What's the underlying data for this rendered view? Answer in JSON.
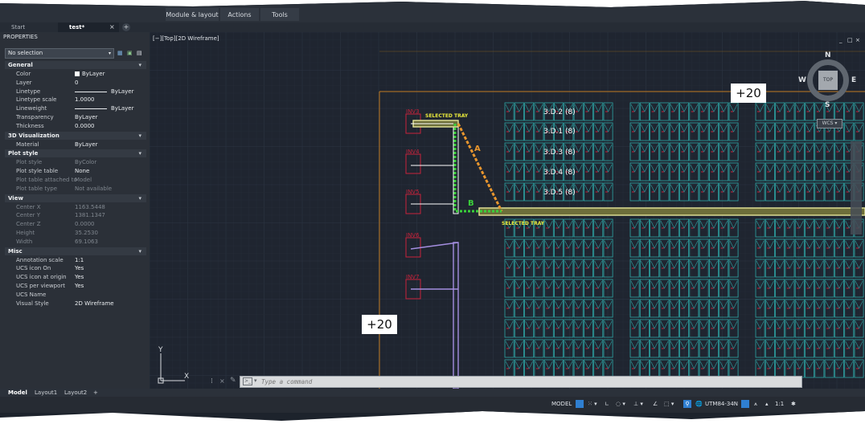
{
  "ribbon": {
    "tabs": [
      "Module & layout",
      "Actions",
      "Tools"
    ]
  },
  "doc_tabs": {
    "start": "Start",
    "active": "test*",
    "close": "×",
    "add": "+"
  },
  "properties": {
    "title": "PROPERTIES",
    "selection": "No selection",
    "sections": [
      {
        "name": "General",
        "rows": [
          {
            "key": "Color",
            "value": "ByLayer",
            "swatch": "#ffffff"
          },
          {
            "key": "Layer",
            "value": "0"
          },
          {
            "key": "Linetype",
            "value": "ByLayer",
            "line": true
          },
          {
            "key": "Linetype scale",
            "value": "1.0000"
          },
          {
            "key": "Lineweight",
            "value": "ByLayer",
            "line": true
          },
          {
            "key": "Transparency",
            "value": "ByLayer"
          },
          {
            "key": "Thickness",
            "value": "0.0000"
          }
        ]
      },
      {
        "name": "3D Visualization",
        "rows": [
          {
            "key": "Material",
            "value": "ByLayer"
          }
        ]
      },
      {
        "name": "Plot style",
        "rows": [
          {
            "key": "Plot style",
            "value": "ByColor",
            "disabled": true
          },
          {
            "key": "Plot style table",
            "value": "None"
          },
          {
            "key": "Plot table attached to",
            "value": "Model",
            "disabled": true
          },
          {
            "key": "Plot table type",
            "value": "Not available",
            "disabled": true
          }
        ]
      },
      {
        "name": "View",
        "rows": [
          {
            "key": "Center X",
            "value": "1163.5448",
            "disabled": true
          },
          {
            "key": "Center Y",
            "value": "1381.1347",
            "disabled": true
          },
          {
            "key": "Center Z",
            "value": "0.0000",
            "disabled": true
          },
          {
            "key": "Height",
            "value": "35.2530",
            "disabled": true
          },
          {
            "key": "Width",
            "value": "69.1063",
            "disabled": true
          }
        ]
      },
      {
        "name": "Misc",
        "rows": [
          {
            "key": "Annotation scale",
            "value": "1:1"
          },
          {
            "key": "UCS icon On",
            "value": "Yes"
          },
          {
            "key": "UCS icon at origin",
            "value": "Yes"
          },
          {
            "key": "UCS per viewport",
            "value": "Yes"
          },
          {
            "key": "UCS Name",
            "value": ""
          },
          {
            "key": "Visual Style",
            "value": "2D Wireframe"
          }
        ]
      }
    ]
  },
  "viewport": {
    "label": "[−][Top][2D Wireframe]",
    "controls": [
      "_",
      "□",
      "×"
    ],
    "viewcube": {
      "n": "N",
      "s": "S",
      "e": "E",
      "w": "W",
      "top": "TOP",
      "wcs": "WCS ▾"
    },
    "elevation_labels": [
      "+20",
      "+20"
    ],
    "inverters": [
      "INV3",
      "INV4",
      "INV5",
      "INV6",
      "INV7"
    ],
    "tray_labels": [
      "SELECTED TRAY",
      "SELECTED TRAY"
    ],
    "segment_labels": [
      "A",
      "B"
    ],
    "strings": [
      "3.D.2 (8)",
      "3.D.1 (8)",
      "3.D.3 (8)",
      "3.D.4 (8)",
      "3.D.5 (8)"
    ],
    "ucs": {
      "x": "X",
      "y": "Y"
    }
  },
  "command": {
    "placeholder": "Type a command"
  },
  "layout_tabs": [
    "Model",
    "Layout1",
    "Layout2",
    "+"
  ],
  "status": {
    "model": "MODEL",
    "coord_system": "UTM84-34N",
    "scale": "1:1"
  },
  "colors": {
    "tray": "#e7e79a",
    "panel": "#2ea6a6",
    "inverter": "#c8223b",
    "route_a": "#e8962e",
    "route_b": "#3ad13a",
    "boundary": "#c07a22"
  }
}
